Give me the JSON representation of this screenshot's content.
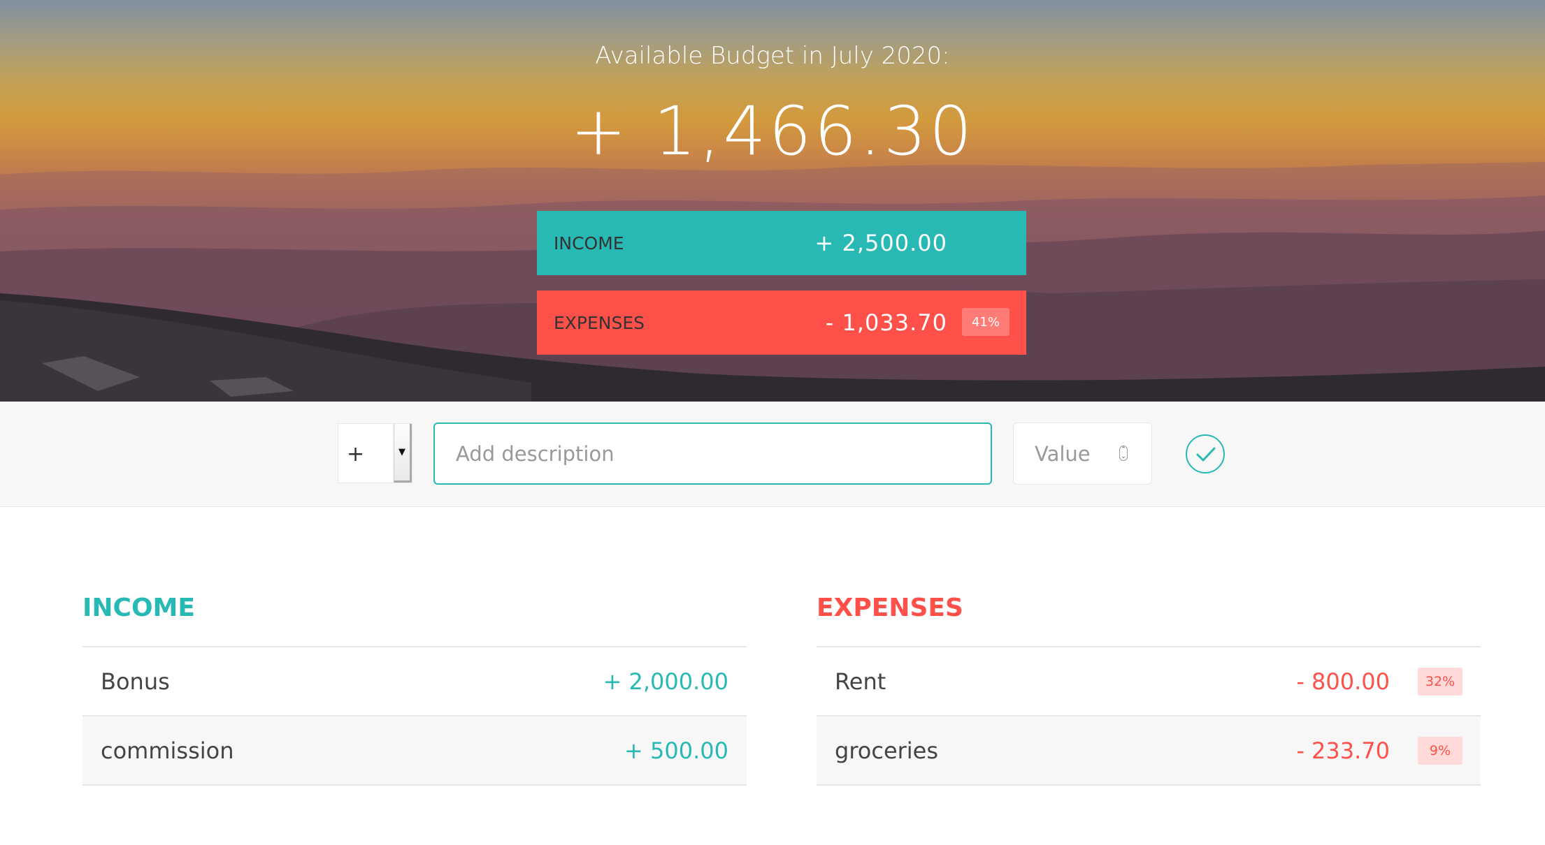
{
  "header": {
    "title": "Available Budget in July 2020:",
    "budget": "+ 1,466.30",
    "income": {
      "label": "INCOME",
      "value": "+ 2,500.00"
    },
    "expenses": {
      "label": "EXPENSES",
      "value": "- 1,033.70",
      "percentage": "41%"
    }
  },
  "add_form": {
    "type_value": "+",
    "description_placeholder": "Add description",
    "value_placeholder": "Value",
    "submit_icon": "checkmark-circle-icon"
  },
  "income_list": {
    "title": "INCOME",
    "items": [
      {
        "description": "Bonus",
        "value": "+ 2,000.00"
      },
      {
        "description": "commission",
        "value": "+ 500.00"
      }
    ]
  },
  "expenses_list": {
    "title": "EXPENSES",
    "items": [
      {
        "description": "Rent",
        "value": "- 800.00",
        "percentage": "32%"
      },
      {
        "description": "groceries",
        "value": "- 233.70",
        "percentage": "9%"
      }
    ]
  },
  "colors": {
    "income": "#28b9b5",
    "expenses": "#ff5049"
  }
}
